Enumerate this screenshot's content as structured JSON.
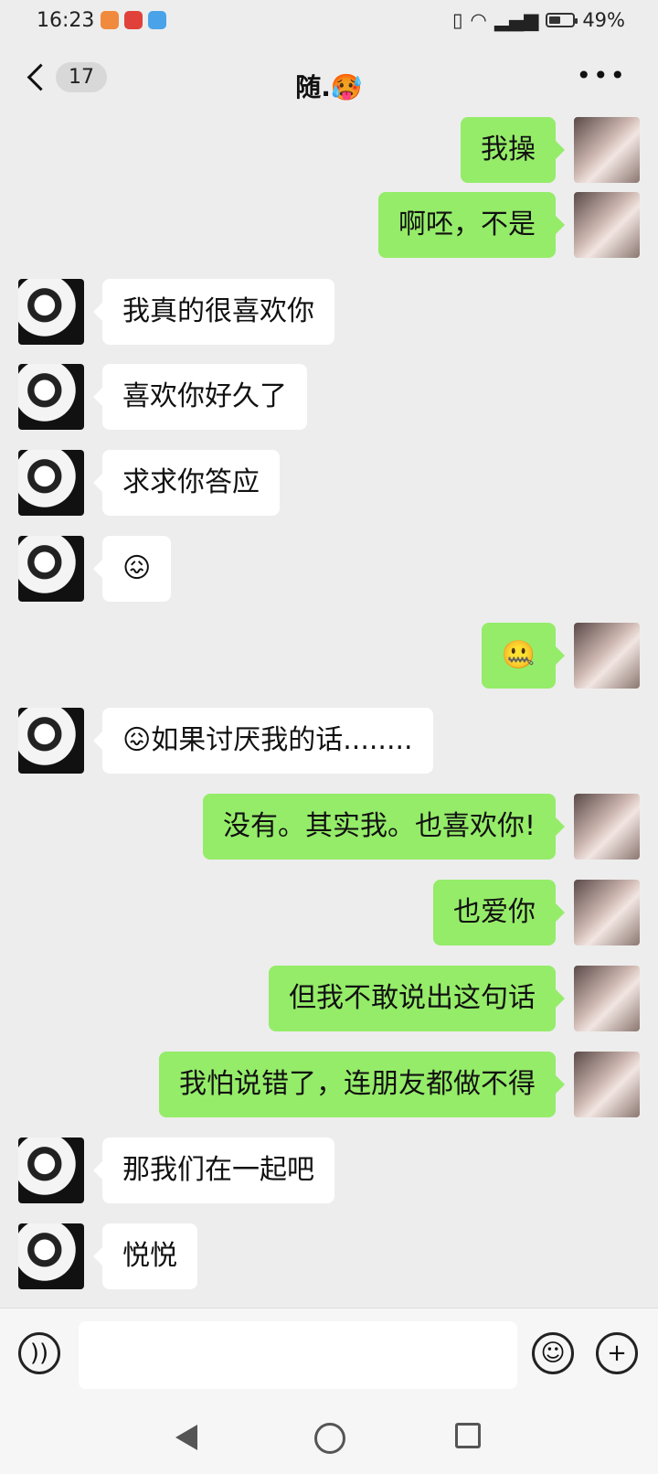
{
  "status_bar": {
    "time": "16:23",
    "battery": "49%",
    "battery_level": 0.49
  },
  "header": {
    "unread_count": "17",
    "title": "随.🥵",
    "more_icon": "more-icon"
  },
  "messages": [
    {
      "side": "right",
      "text": "我操"
    },
    {
      "side": "right",
      "text": "啊呸，不是"
    },
    {
      "side": "left",
      "text": "我真的很喜欢你"
    },
    {
      "side": "left",
      "text": "喜欢你好久了"
    },
    {
      "side": "left",
      "text": " 求求你答应"
    },
    {
      "side": "left",
      "text": "😖"
    },
    {
      "side": "right",
      "text": "🤐"
    },
    {
      "side": "left",
      "text": "😖如果讨厌我的话........"
    },
    {
      "side": "right",
      "text": "没有。其实我。也喜欢你!"
    },
    {
      "side": "right",
      "text": "也爱你"
    },
    {
      "side": "right",
      "text": "但我不敢说出这句话"
    },
    {
      "side": "right",
      "text": "我怕说错了，连朋友都做不得"
    },
    {
      "side": "left",
      "text": "那我们在一起吧"
    },
    {
      "side": "left",
      "text": "悦悦"
    }
  ],
  "input": {
    "value": ""
  }
}
